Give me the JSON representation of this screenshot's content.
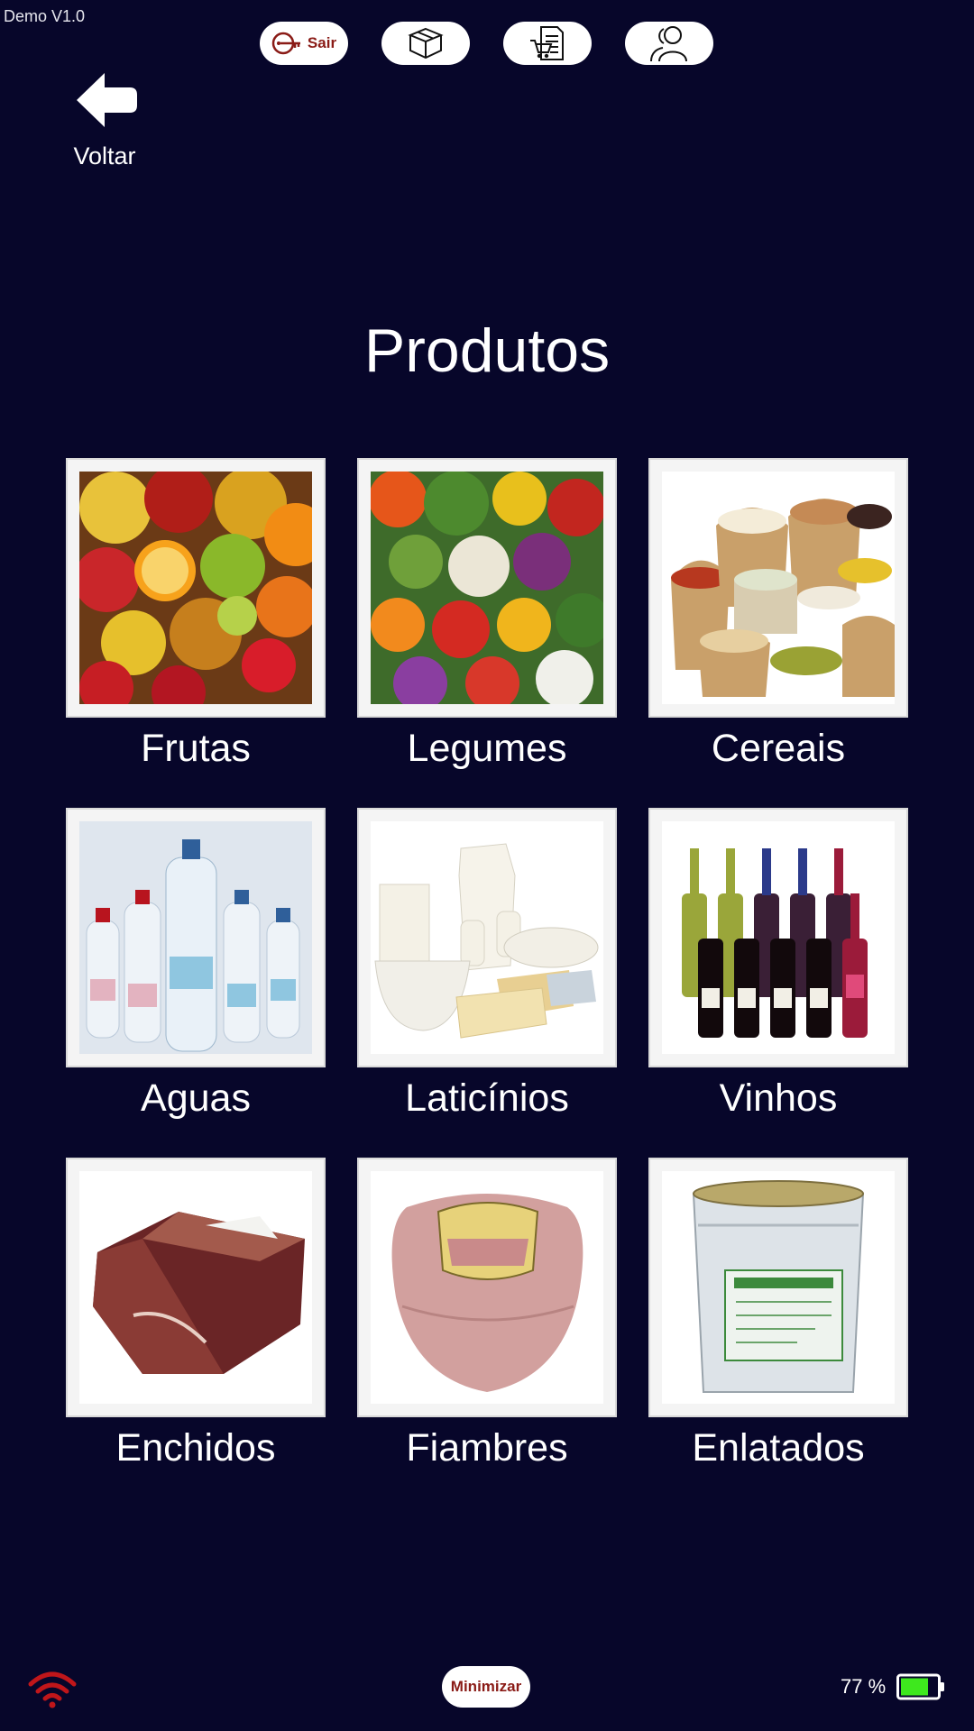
{
  "app": {
    "version": "Demo V1.0"
  },
  "toolbar": {
    "logout_label": "Sair",
    "logout_icon": "key-icon",
    "products_icon": "box-icon",
    "orders_icon": "cart-document-icon",
    "users_icon": "users-icon"
  },
  "nav": {
    "back_label": "Voltar",
    "back_icon": "arrow-left-icon"
  },
  "page": {
    "title": "Produtos"
  },
  "categories": [
    {
      "label": "Frutas"
    },
    {
      "label": "Legumes"
    },
    {
      "label": "Cereais"
    },
    {
      "label": "Aguas"
    },
    {
      "label": "Laticínios"
    },
    {
      "label": "Vinhos"
    },
    {
      "label": "Enchidos"
    },
    {
      "label": "Fiambres"
    },
    {
      "label": "Enlatados"
    }
  ],
  "footer": {
    "minimize_label": "Minimizar",
    "battery_text": "77 %",
    "battery_level": 0.77,
    "wifi_icon": "wifi-icon",
    "battery_icon": "battery-icon"
  },
  "colors": {
    "background": "#07062a",
    "accent": "#8a1b16",
    "wifi": "#c0161a",
    "battery_fill": "#3ee81e"
  }
}
